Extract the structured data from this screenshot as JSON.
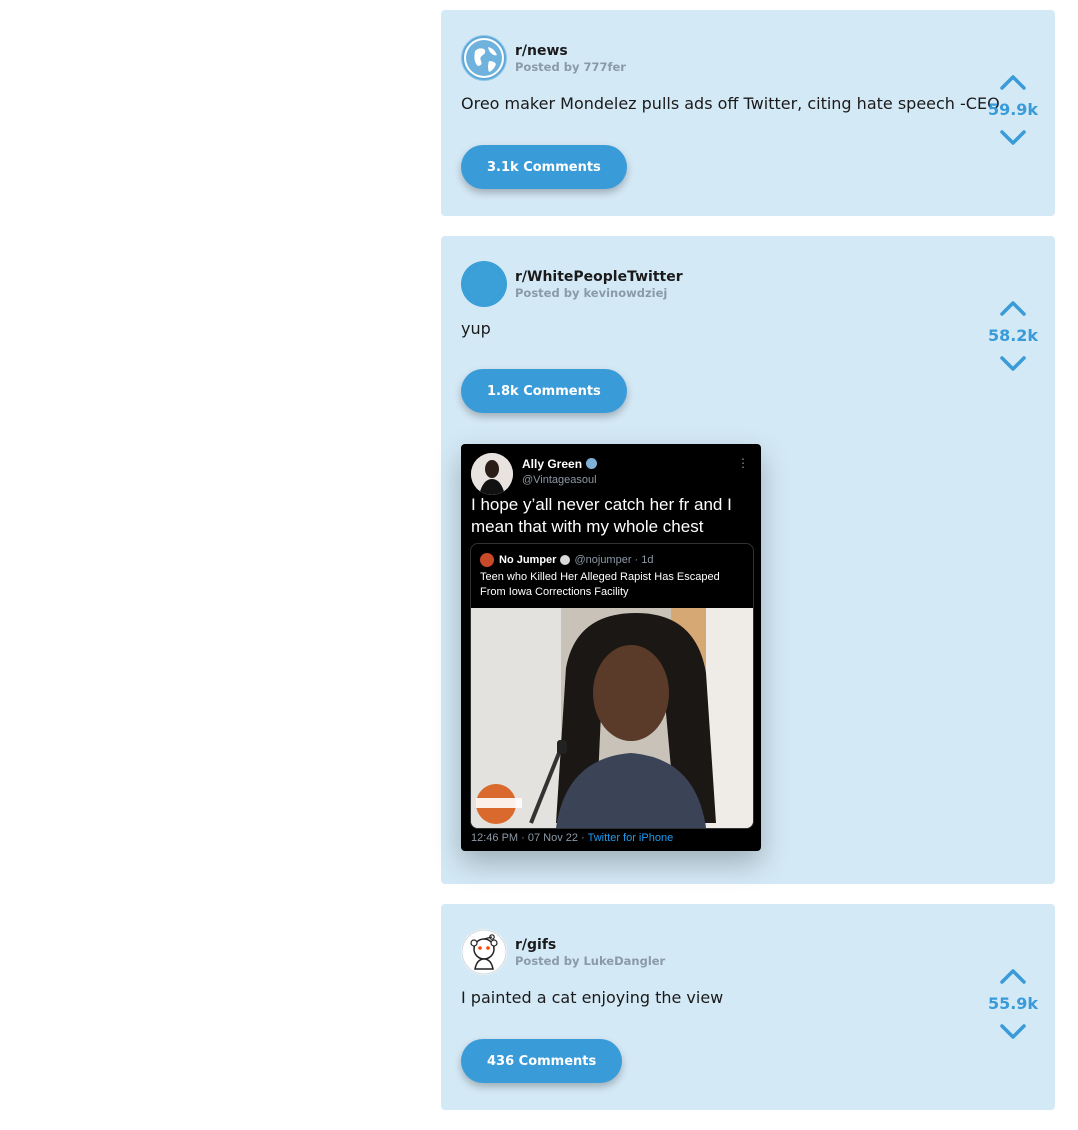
{
  "colors": {
    "card_bg": "#d4e9f6",
    "accent": "#3a9bd9",
    "posted_by": "#8a9aa6"
  },
  "posts": [
    {
      "subreddit": "r/news",
      "posted_by": "Posted by 777fer",
      "title": "Oreo maker Mondelez pulls ads off Twitter, citing hate speech -CEO",
      "comments": "3.1k Comments",
      "score": "59.9k",
      "avatar_icon": "globe-icon"
    },
    {
      "subreddit": "r/WhitePeopleTwitter",
      "posted_by": "Posted by kevinowdziej",
      "title": "yup",
      "comments": "1.8k Comments",
      "score": "58.2k",
      "avatar_icon": "default-avatar",
      "image": {
        "tweet_author": "Ally Green",
        "tweet_handle": "@Vintageasoul",
        "tweet_text": "I hope y’all never catch her fr and I mean that with my whole chest",
        "quote_author": "No Jumper",
        "quote_handle": "@nojumper · 1d",
        "quote_text": "Teen who Killed Her Alleged Rapist Has Escaped From Iowa Corrections Facility",
        "watermark": "NO JUMPER",
        "footer_time": "12:46 PM · 07 Nov 22 · ",
        "footer_source": "Twitter for iPhone"
      }
    },
    {
      "subreddit": "r/gifs",
      "posted_by": "Posted by LukeDangler",
      "title": "I painted a cat enjoying the view",
      "comments": "436 Comments",
      "score": "55.9k",
      "avatar_icon": "snoo-icon"
    }
  ]
}
